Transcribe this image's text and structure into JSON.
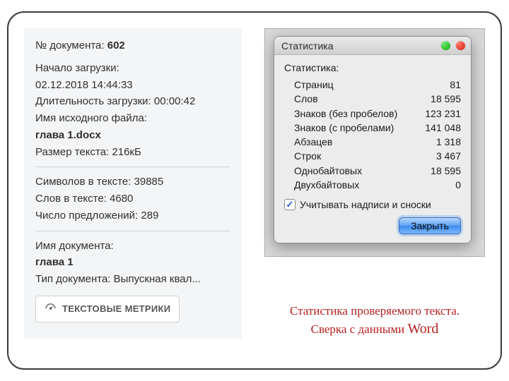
{
  "left": {
    "docnum_label": "№ документа:",
    "docnum_value": "602",
    "start_label": "Начало загрузки:",
    "start_value": "02.12.2018 14:44:33",
    "duration_label": "Длительность загрузки:",
    "duration_value": "00:00:42",
    "srcname_label": "Имя исходного файла:",
    "srcname_value": "глава 1.docx",
    "size_label": "Размер текста:",
    "size_value": "216кБ",
    "chars_label": "Символов в тексте:",
    "chars_value": "39885",
    "words_label": "Слов в тексте:",
    "words_value": "4680",
    "sentences_label": "Число предложений:",
    "sentences_value": "289",
    "docname_label": "Имя документа:",
    "docname_value": "глава 1",
    "doctype_label": "Тип документа:",
    "doctype_value": "Выпускная квал...",
    "metrics_btn": "ТЕКСТОВЫЕ МЕТРИКИ"
  },
  "mac": {
    "window_title": "Статистика",
    "heading": "Статистика:",
    "rows": {
      "pages_label": "Страниц",
      "pages_value": "81",
      "words_label": "Слов",
      "words_value": "18 595",
      "charsnos_label": "Знаков (без пробелов)",
      "charsnos_value": "123 231",
      "charsws_label": "Знаков (с пробелами)",
      "charsws_value": "141 048",
      "paras_label": "Абзацев",
      "paras_value": "1 318",
      "lines_label": "Строк",
      "lines_value": "3 467",
      "single_label": "Однобайтовых",
      "single_value": "18 595",
      "double_label": "Двухбайтовых",
      "double_value": "0"
    },
    "checkbox_label": "Учитывать надписи и сноски",
    "close_btn": "Закрыть"
  },
  "caption": {
    "line1": "Статистика проверяемого текста.",
    "line2a": "Сверка с данными ",
    "line2b": "Word"
  }
}
